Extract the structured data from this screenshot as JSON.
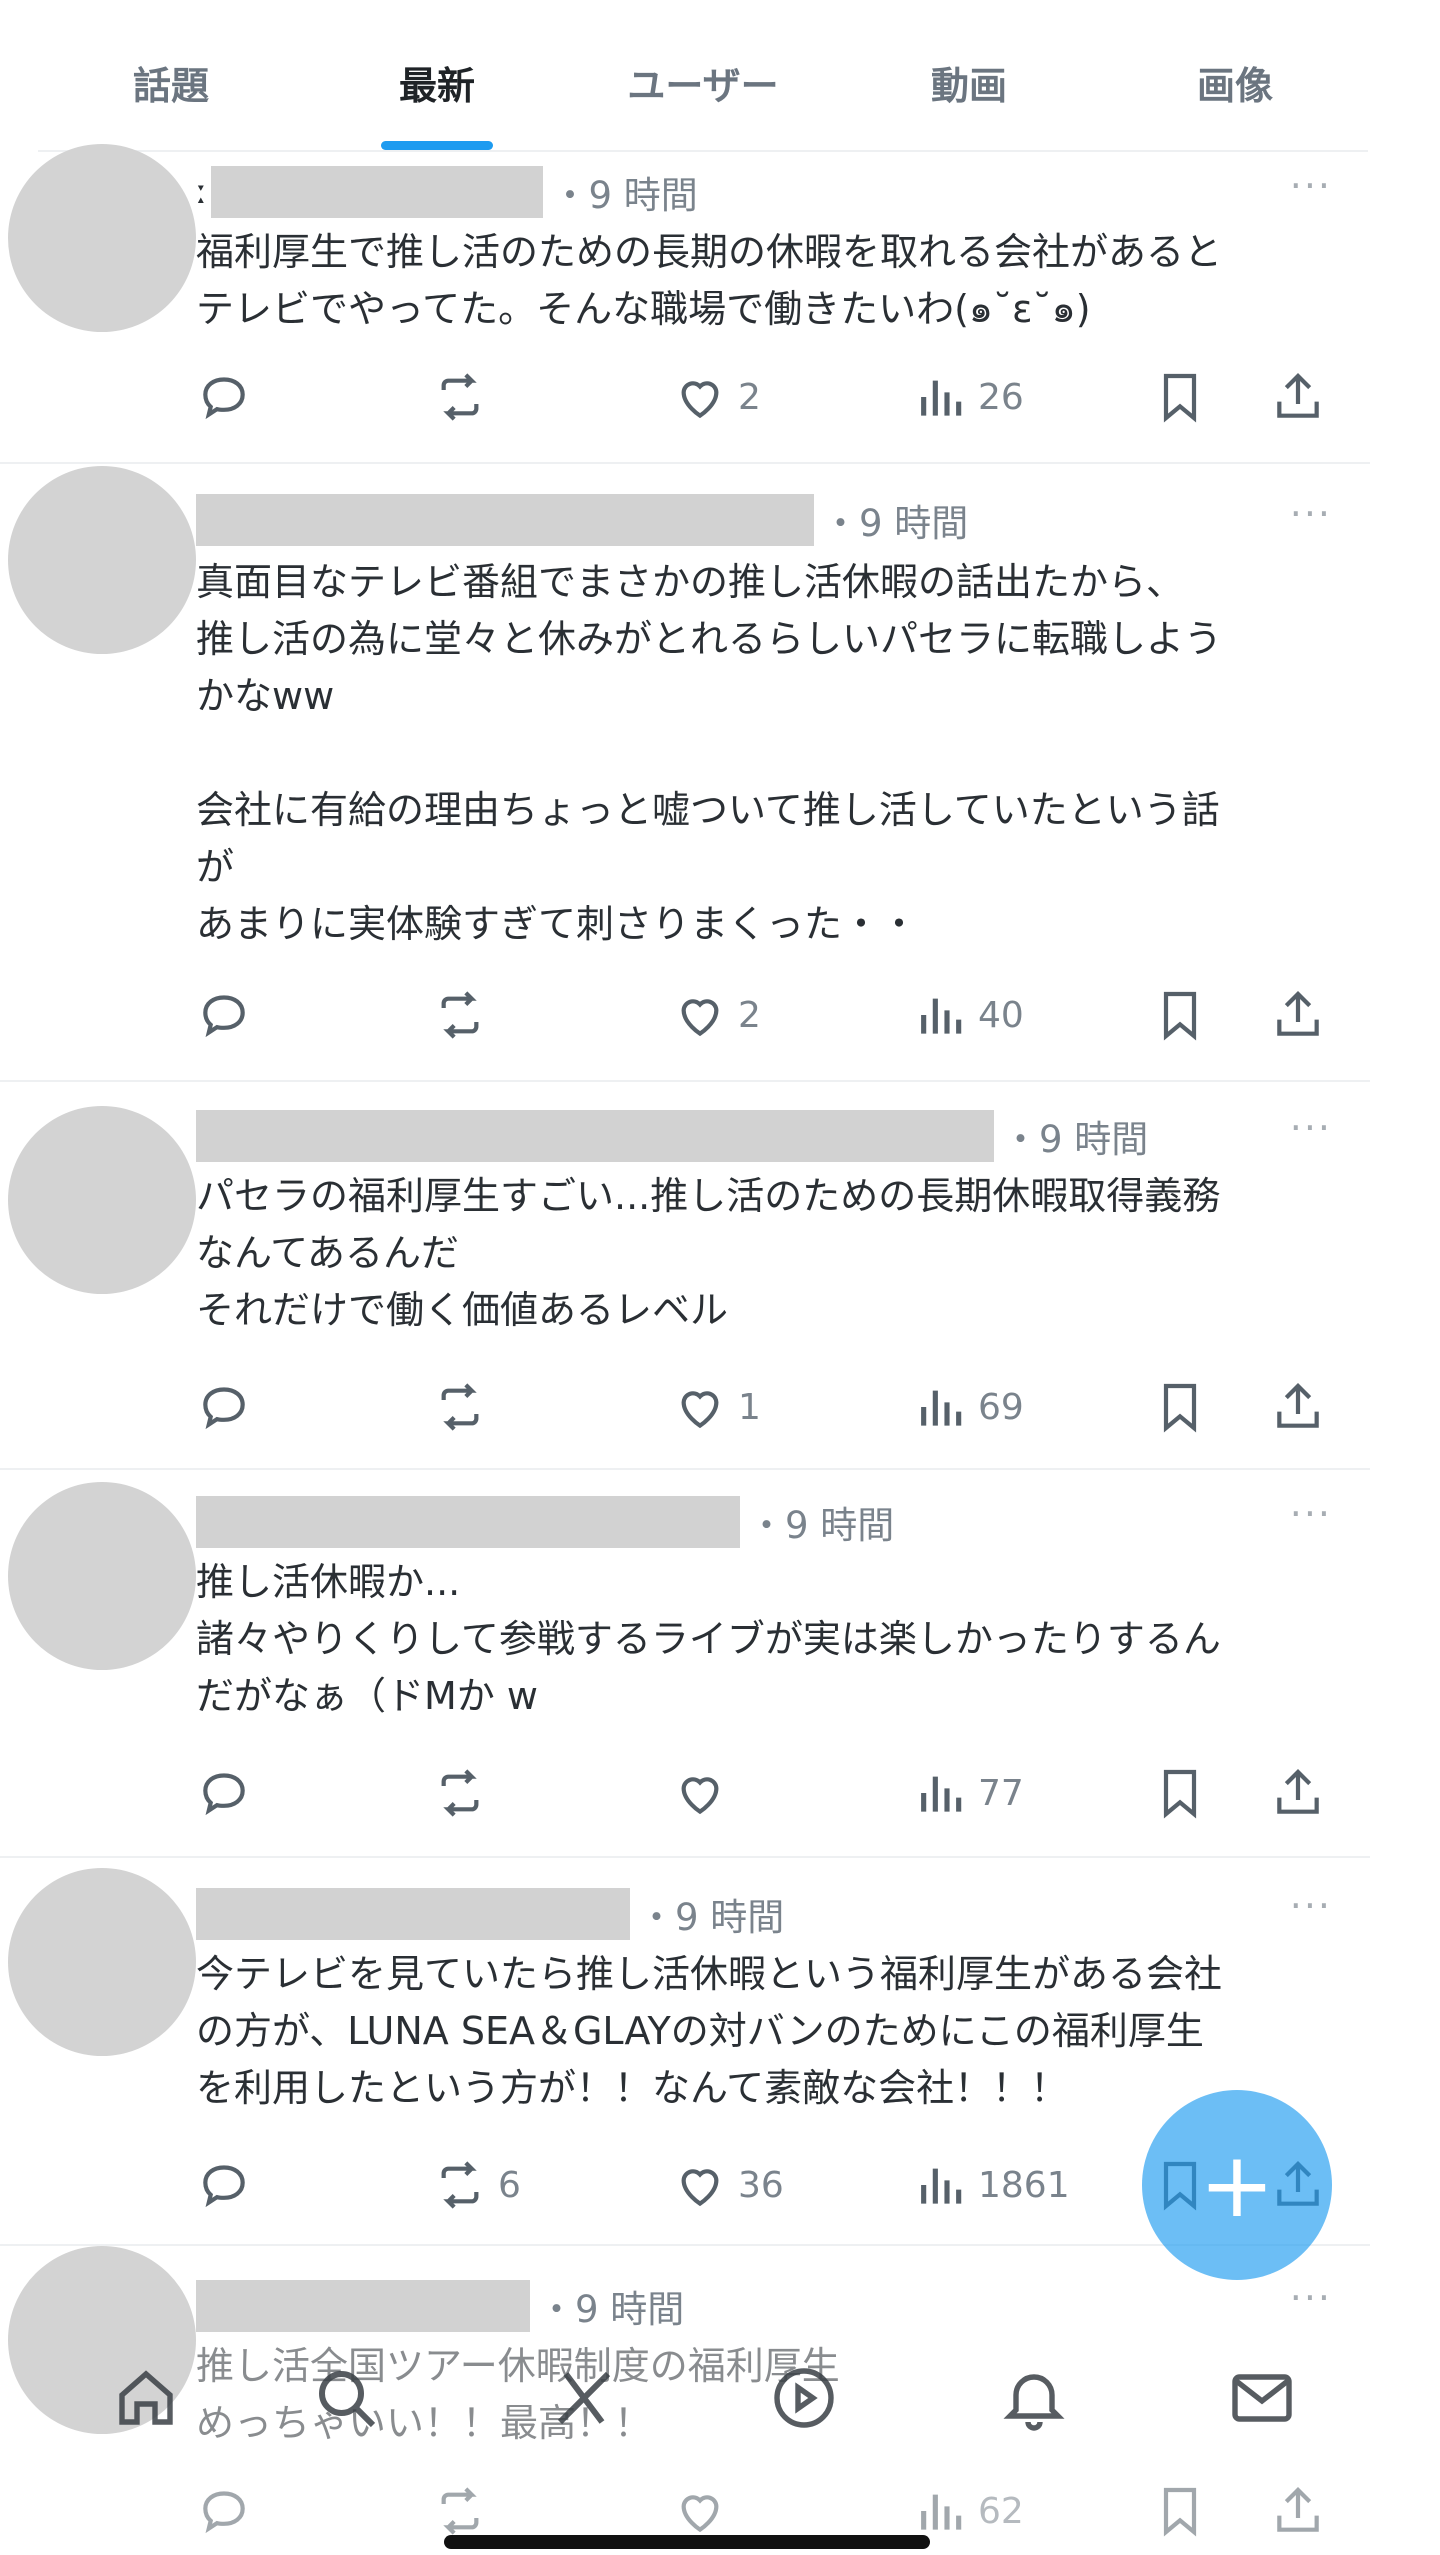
{
  "tabs": [
    "話題",
    "最新",
    "ユーザー",
    "動画",
    "画像"
  ],
  "active_tab": 1,
  "more_label": "···",
  "posts": [
    {
      "prefix": "ː",
      "time": "・9 時間",
      "text": "福利厚生で推し活のための長期の休暇を取れる会社があると\nテレビでやってた。そんな職場で働きたいわ(๑˘ε˘๑)",
      "reply": "",
      "repost": "",
      "like": "2",
      "views": "26"
    },
    {
      "prefix": "",
      "time": "・9 時間",
      "text": "真面目なテレビ番組でまさかの推し活休暇の話出たから、\n推し活の為に堂々と休みがとれるらしいパセラに転職しよう\nかなww\n\n会社に有給の理由ちょっと嘘ついて推し活していたという話\nが\nあまりに実体験すぎて刺さりまくった・・",
      "reply": "",
      "repost": "",
      "like": "2",
      "views": "40"
    },
    {
      "prefix": "",
      "time": "・9 時間",
      "text": "パセラの福利厚生すごい...推し活のための長期休暇取得義務\nなんてあるんだ\nそれだけで働く価値あるレベル",
      "reply": "",
      "repost": "",
      "like": "1",
      "views": "69"
    },
    {
      "prefix": "",
      "time": "・9 時間",
      "text": "推し活休暇か...\n諸々やりくりして参戦するライブが実は楽しかったりするん\nだがなぁ（ドMか w",
      "reply": "",
      "repost": "",
      "like": "",
      "views": "77"
    },
    {
      "prefix": "",
      "time": "・9 時間",
      "text": "今テレビを見ていたら推し活休暇という福利厚生がある会社\nの方が、LUNA SEA＆GLAYの対バンのためにこの福利厚生\nを利用したという方が！！なんて素敵な会社！！！",
      "reply": "",
      "repost": "6",
      "like": "36",
      "views": "1861"
    },
    {
      "prefix": "",
      "time": "・9 時間",
      "text": "推し活全国ツアー休暇制度の福利厚生\nめっちゃいい！！最高！！",
      "reply": "",
      "repost": "",
      "like": "",
      "views": "62"
    }
  ],
  "bottom_nav": [
    "home-icon",
    "search-icon",
    "grok-icon",
    "video-icon",
    "bell-icon",
    "mail-icon"
  ],
  "colors": {
    "accent": "#1d9bf0",
    "avatar": "#d3d3d3",
    "text": "#2a2f34"
  }
}
